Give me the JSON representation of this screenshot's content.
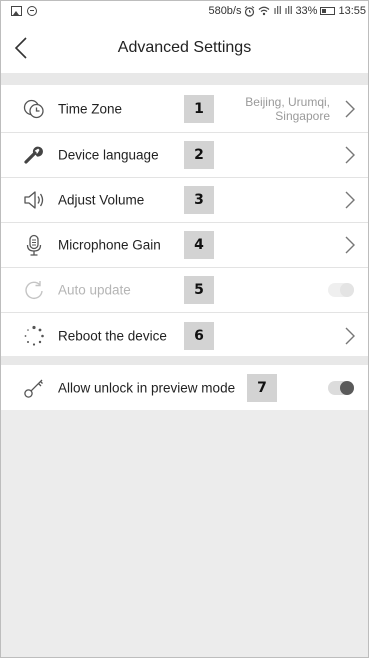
{
  "status_bar": {
    "net_speed": "580b/s",
    "signal_text": "ıll ıll",
    "battery": "33%",
    "time": "13:55"
  },
  "header": {
    "title": "Advanced Settings"
  },
  "settings": [
    {
      "label": "Time Zone",
      "number": "1",
      "value_line1": "Beijing, Urumqi,",
      "value_line2": "Singapore",
      "icon": "clock-icon"
    },
    {
      "label": "Device language",
      "number": "2",
      "icon": "wrench-icon"
    },
    {
      "label": "Adjust Volume",
      "number": "3",
      "icon": "speaker-icon"
    },
    {
      "label": "Microphone Gain",
      "number": "4",
      "icon": "microphone-icon"
    },
    {
      "label": "Auto update",
      "number": "5",
      "icon": "refresh-icon",
      "enabled": false
    },
    {
      "label": "Reboot the device",
      "number": "6",
      "icon": "reboot-icon"
    }
  ],
  "preview": {
    "label": "Allow unlock in preview mode",
    "number": "7",
    "icon": "key-icon"
  }
}
